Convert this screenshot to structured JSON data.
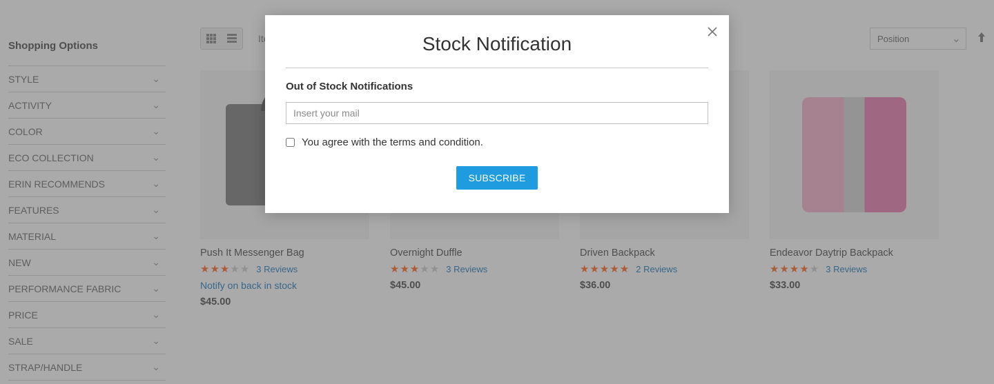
{
  "sidebar": {
    "title": "Shopping Options",
    "filters": [
      "STYLE",
      "ACTIVITY",
      "COLOR",
      "ECO COLLECTION",
      "ERIN RECOMMENDS",
      "FEATURES",
      "MATERIAL",
      "NEW",
      "PERFORMANCE FABRIC",
      "PRICE",
      "SALE",
      "STRAP/HANDLE"
    ]
  },
  "toolbar": {
    "items_label": "Items",
    "sort_value": "Position"
  },
  "products": [
    {
      "name": "Push It Messenger Bag",
      "rating": 3,
      "reviews": "3 Reviews",
      "notify": "Notify on back in stock",
      "price": "$45.00"
    },
    {
      "name": "Overnight Duffle",
      "rating": 3,
      "reviews": "3 Reviews",
      "price": "$45.00"
    },
    {
      "name": "Driven Backpack",
      "rating": 4.5,
      "reviews": "2 Reviews",
      "price": "$36.00"
    },
    {
      "name": "Endeavor Daytrip Backpack",
      "rating": 3.5,
      "reviews": "3 Reviews",
      "price": "$33.00"
    }
  ],
  "modal": {
    "title": "Stock Notification",
    "label": "Out of Stock Notifications",
    "placeholder": "Insert your mail",
    "terms": "You agree with the terms and condition.",
    "button": "SUBSCRIBE"
  }
}
